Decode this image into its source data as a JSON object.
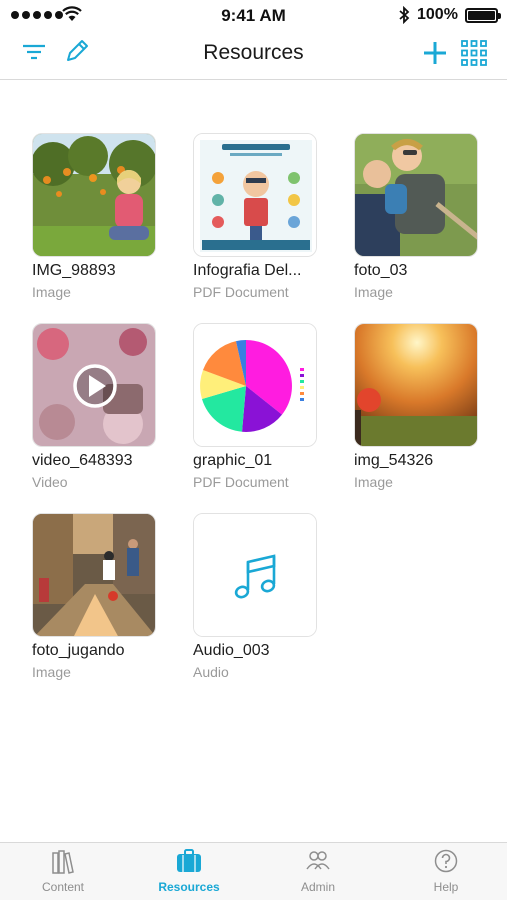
{
  "status": {
    "time": "9:41 AM",
    "battery": "100%"
  },
  "nav": {
    "title": "Resources"
  },
  "resources": [
    {
      "name": "IMG_98893",
      "type": "Image"
    },
    {
      "name": "Infografia Del...",
      "type": "PDF Document"
    },
    {
      "name": "foto_03",
      "type": "Image"
    },
    {
      "name": "video_648393",
      "type": "Video"
    },
    {
      "name": "graphic_01",
      "type": "PDF Document"
    },
    {
      "name": "img_54326",
      "type": "Image"
    },
    {
      "name": "foto_jugando",
      "type": "Image"
    },
    {
      "name": "Audio_003",
      "type": "Audio"
    }
  ],
  "tabs": [
    {
      "label": "Content",
      "icon": "books-icon"
    },
    {
      "label": "Resources",
      "icon": "briefcase-icon"
    },
    {
      "label": "Admin",
      "icon": "users-icon"
    },
    {
      "label": "Help",
      "icon": "help-icon"
    }
  ],
  "colors": {
    "accent": "#1aa8d5",
    "inactive": "#8e8e8e"
  }
}
